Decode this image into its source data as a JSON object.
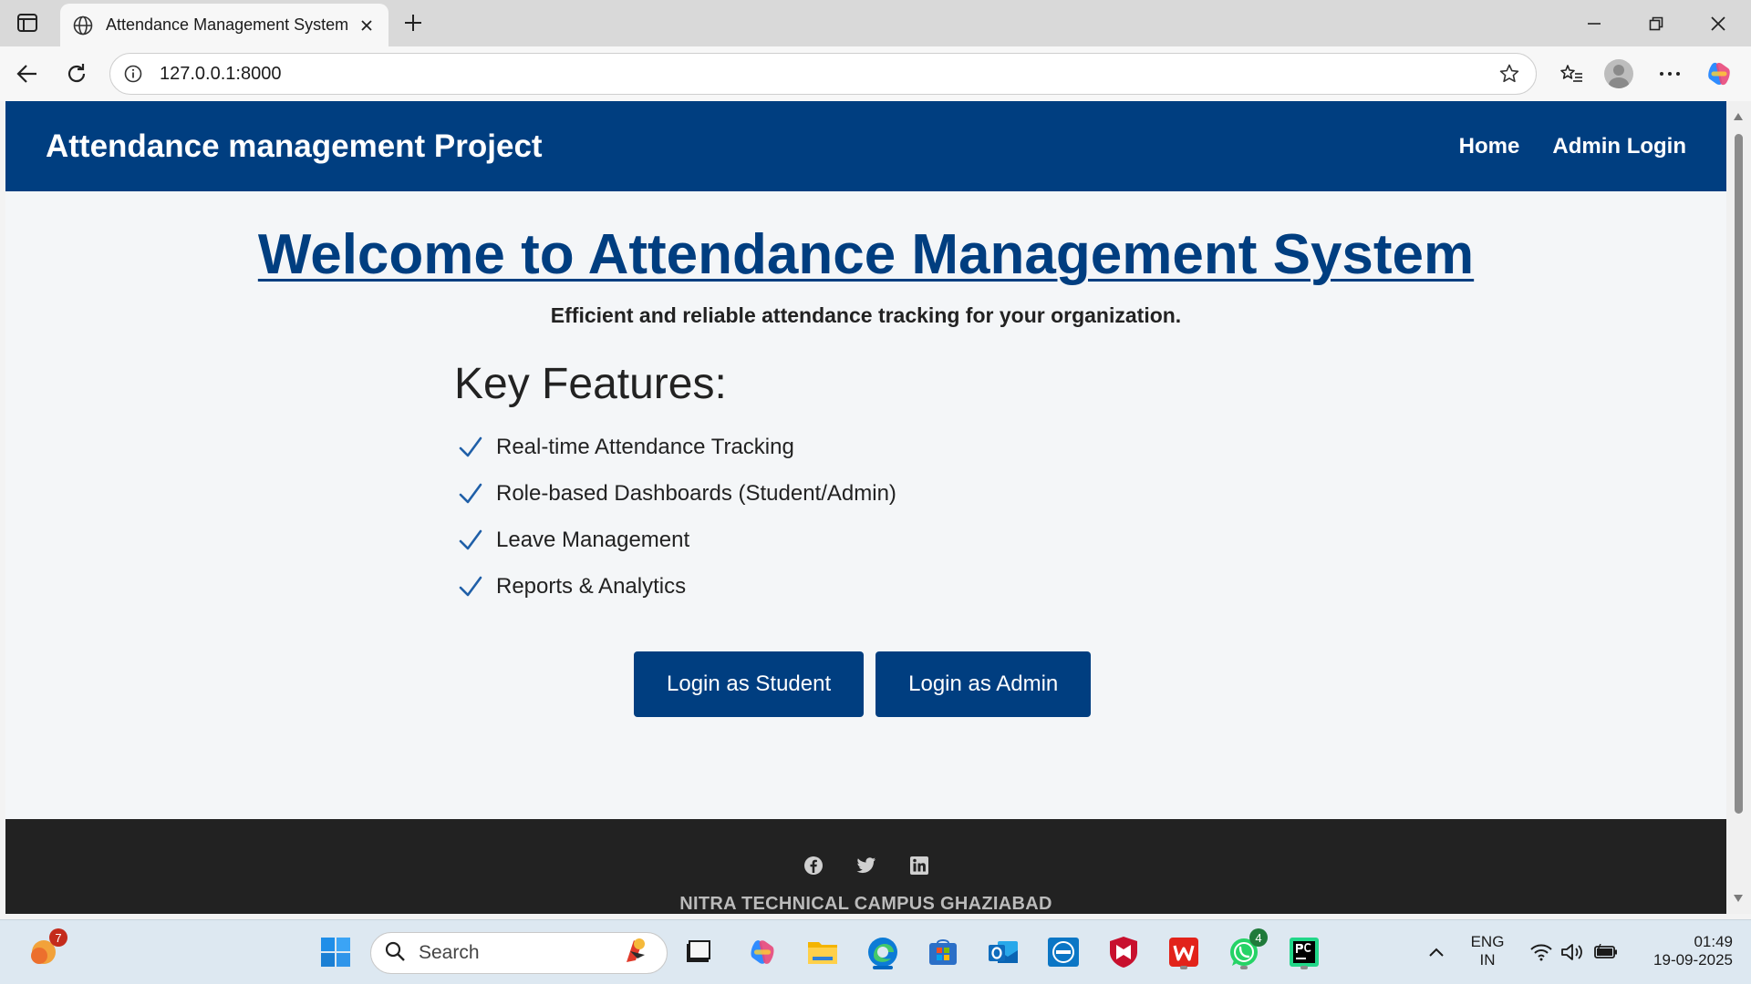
{
  "browser": {
    "tab_title": "Attendance Management System",
    "url": "127.0.0.1:8000"
  },
  "site": {
    "brand": "Attendance management Project",
    "nav": [
      "Home",
      "Admin Login"
    ],
    "hero_title": "Welcome to Attendance Management System",
    "hero_subtitle": "Efficient and reliable attendance tracking for your organization.",
    "features_heading": "Key Features:",
    "features": [
      "Real-time Attendance Tracking",
      "Role-based Dashboards (Student/Admin)",
      "Leave Management",
      "Reports & Analytics"
    ],
    "buttons": {
      "student": "Login as Student",
      "admin": "Login as Admin"
    },
    "footer": {
      "social_icons": [
        "facebook-icon",
        "twitter-icon",
        "linkedin-icon"
      ],
      "text": "NITRA TECHNICAL CAMPUS GHAZIABAD"
    },
    "colors": {
      "primary": "#003e80",
      "footer_bg": "#222222",
      "page_bg": "#f4f6f8"
    }
  },
  "taskbar": {
    "search_label": "Search",
    "badges": {
      "widgets": "7",
      "whatsapp": "4"
    },
    "tray": {
      "lang": "ENG",
      "region": "IN",
      "time": "01:49",
      "date": "19-09-2025"
    }
  }
}
